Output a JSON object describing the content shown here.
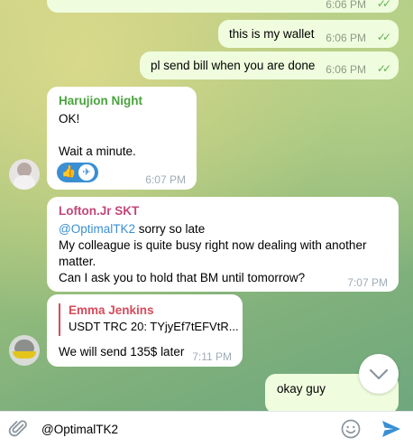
{
  "messages": [
    {
      "type": "out",
      "text": "",
      "time": "6:06 PM"
    },
    {
      "type": "out",
      "text": "this is my wallet",
      "time": "6:06 PM"
    },
    {
      "type": "out",
      "text": "pl send bill when you are done",
      "time": "6:06 PM"
    },
    {
      "type": "in",
      "sender": "Harujion Night",
      "sender_color": "#4aa33f",
      "lines": [
        "OK!",
        "",
        "Wait a minute."
      ],
      "reactions": [
        "👍",
        "✈"
      ],
      "time": "6:07 PM"
    },
    {
      "type": "in",
      "sender": "Lofton.Jr SKT",
      "sender_color": "#c2487a",
      "mention": "@OptimalTK2",
      "line1_rest": " sorry so late",
      "lines": [
        "My colleague is quite busy right now dealing with another",
        "matter.",
        "Can I ask you to hold that BM until tomorrow?"
      ],
      "time": "7:07 PM"
    },
    {
      "type": "in",
      "sender": "Emma Jenkins",
      "sender_color": "#d84a5a",
      "reply_preview": "USDT  TRC 20:  TYjyEf7tEFVtR...",
      "text": "We will send 135$ later",
      "time": "7:11 PM"
    },
    {
      "type": "out",
      "text": "okay guy"
    }
  ],
  "input": {
    "value": "@OptimalTK2"
  },
  "icons": {
    "attach": "paperclip-icon",
    "emoji": "emoji-icon",
    "send": "send-icon",
    "scroll": "chevron-down-icon"
  },
  "colors": {
    "accent": "#3a8fd3",
    "out_bubble": "#effdde",
    "checks": "#5fb053"
  }
}
